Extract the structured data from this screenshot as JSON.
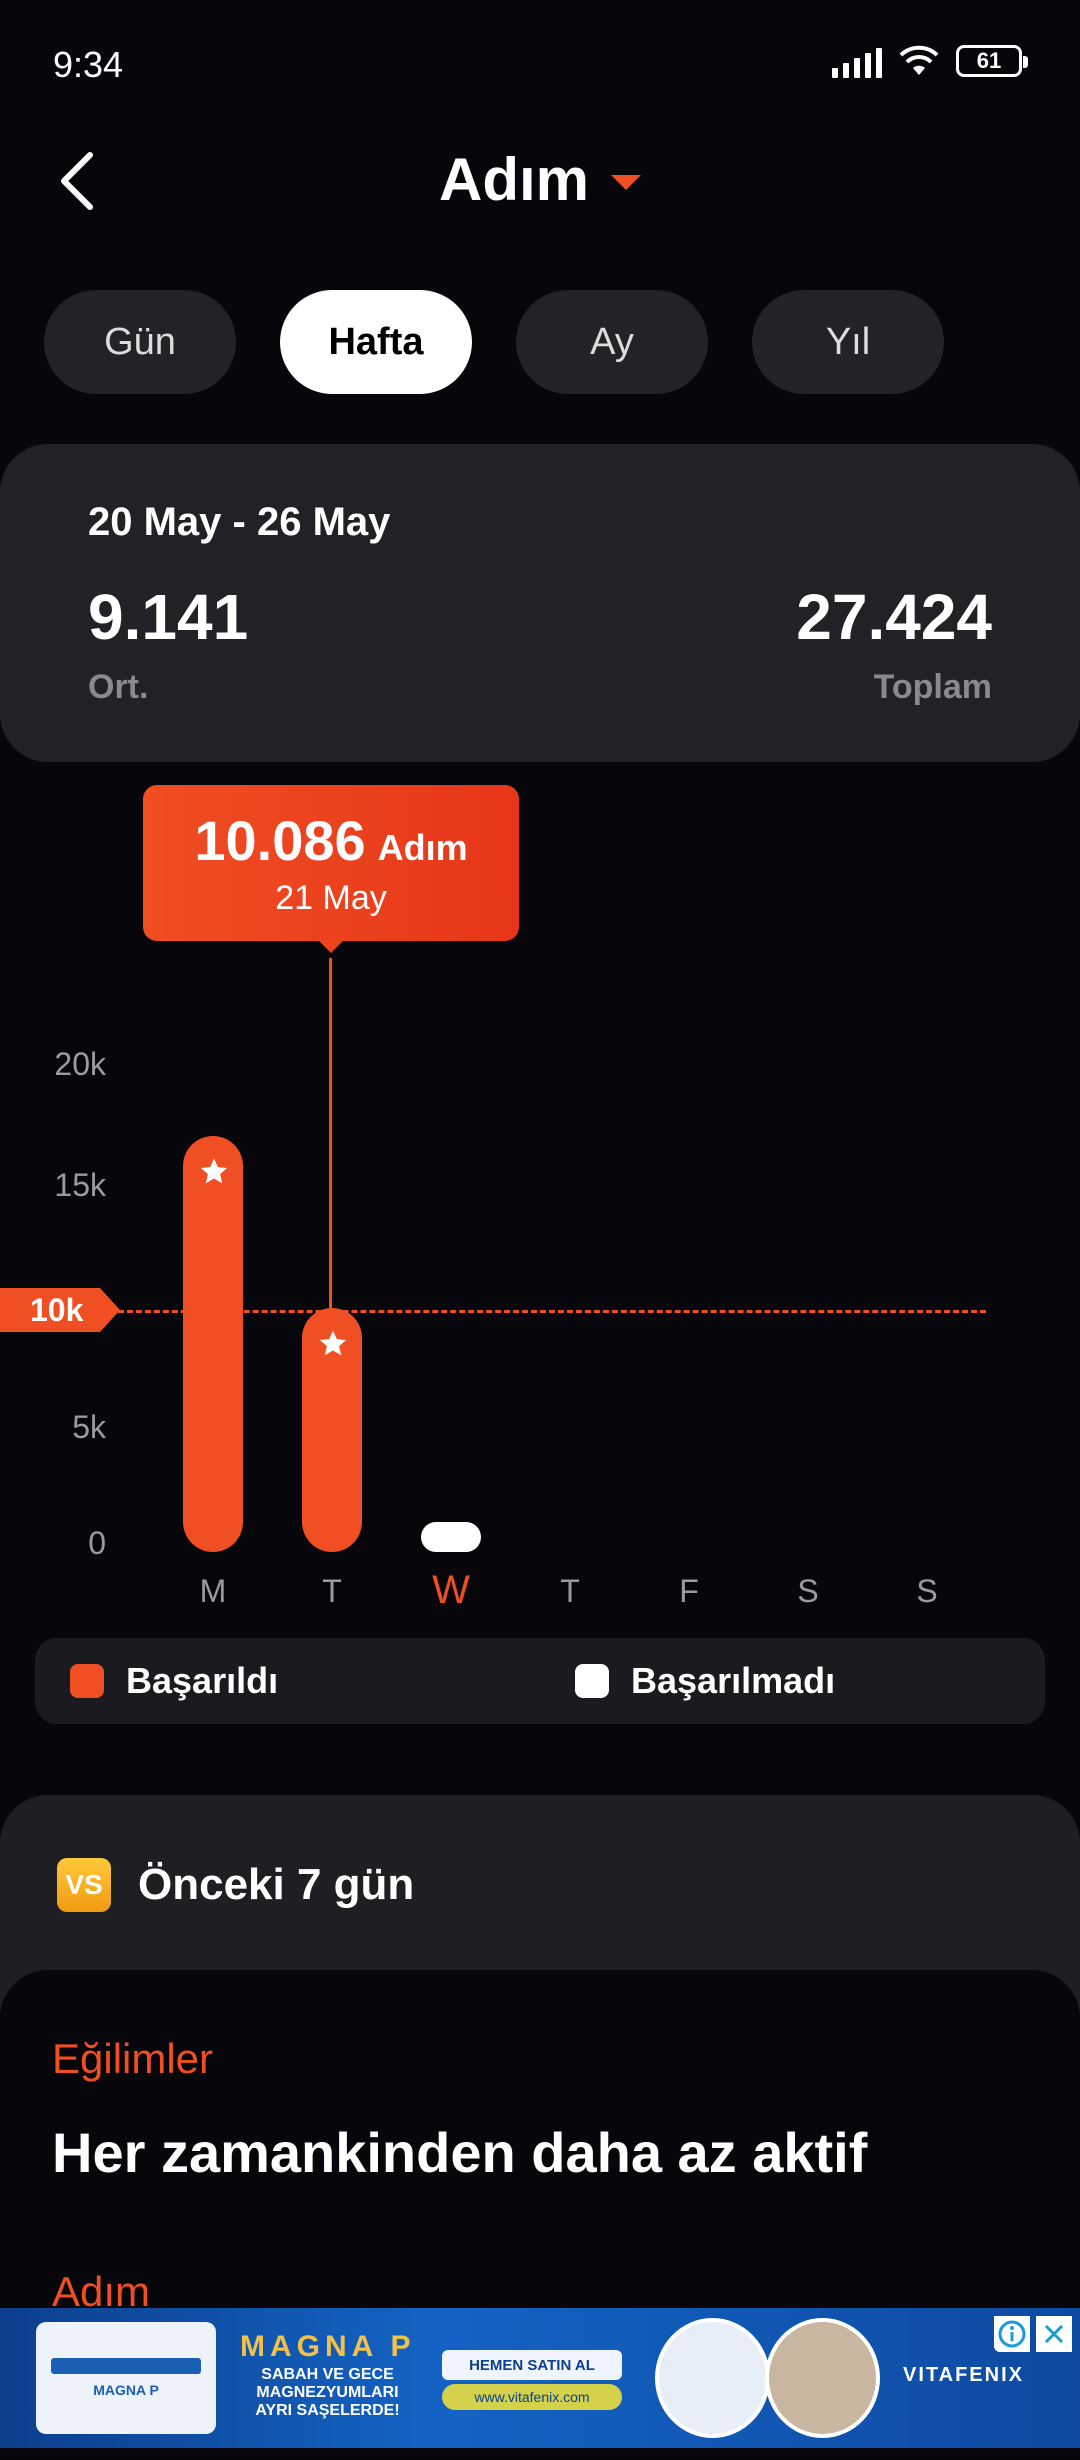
{
  "status_bar": {
    "time": "9:34",
    "battery": "61"
  },
  "header": {
    "title": "Adım"
  },
  "tabs": [
    {
      "label": "Gün",
      "active": false
    },
    {
      "label": "Hafta",
      "active": true
    },
    {
      "label": "Ay",
      "active": false
    },
    {
      "label": "Yıl",
      "active": false
    }
  ],
  "summary": {
    "range": "20 May - 26 May",
    "average": "9.141",
    "average_label": "Ort.",
    "total": "27.424",
    "total_label": "Toplam"
  },
  "tooltip": {
    "value": "10.086",
    "unit": "Adım",
    "date": "21 May"
  },
  "chart_data": {
    "type": "bar",
    "categories": [
      "M",
      "T",
      "W",
      "T",
      "F",
      "S",
      "S"
    ],
    "values": [
      17200,
      10086,
      0,
      null,
      null,
      null,
      null
    ],
    "achieved": [
      true,
      true,
      false,
      null,
      null,
      null,
      null
    ],
    "current_index": 2,
    "selected_index": 1,
    "ylim": [
      0,
      20000
    ],
    "yticks": [
      "0",
      "5k",
      "10k",
      "15k",
      "20k"
    ],
    "goal": 10000,
    "goal_label": "10k",
    "legend": [
      "Başarıldı",
      "Başarılmadı"
    ],
    "colors": {
      "achieved": "#f04e23",
      "not_achieved": "#ffffff"
    }
  },
  "compare": {
    "badge": "VS",
    "label": "Önceki 7 gün"
  },
  "trends": {
    "heading": "Eğilimler",
    "text": "Her zamankinden daha az aktif",
    "sub_heading": "Adım"
  },
  "ad": {
    "brand": "MAGNA P",
    "tagline_1": "SABAH VE GECE",
    "tagline_2": "MAGNEZYUMLARI",
    "tagline_3": "AYRI SAŞELERDE!",
    "cta": "HEMEN SATIN AL",
    "url": "www.vitafenix.com",
    "logo": "VITAFENIX",
    "product_name": "MAGNA P"
  }
}
